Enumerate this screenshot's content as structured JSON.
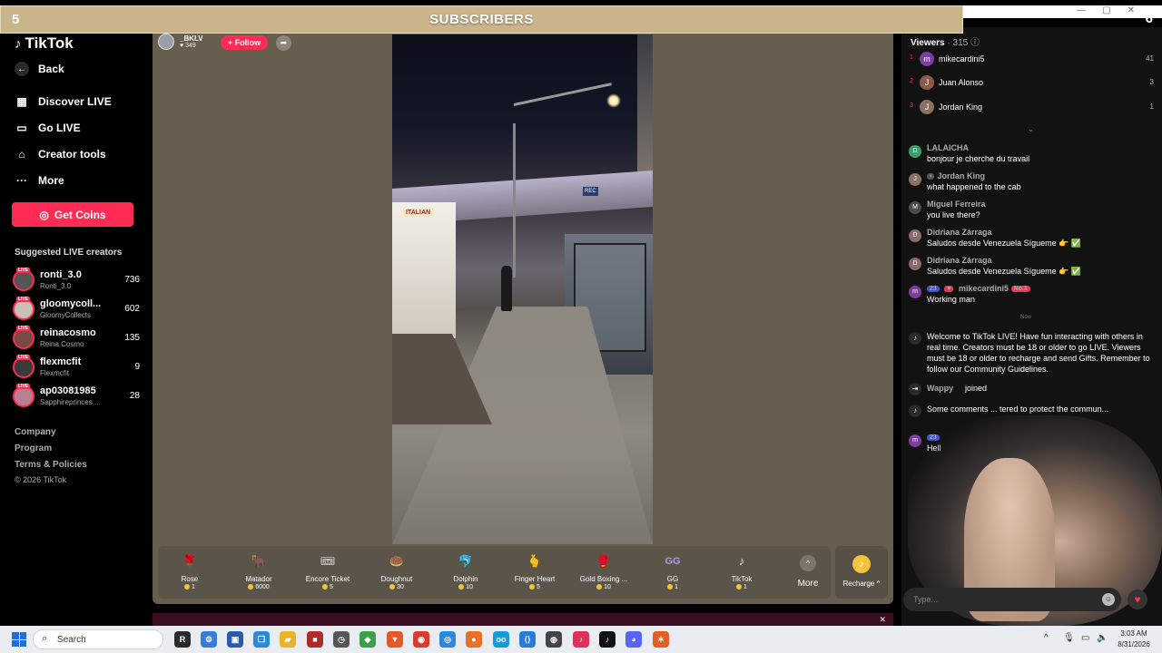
{
  "overlay": {
    "title": "SUBSCRIBERS",
    "left_count": "5",
    "right_count": "6"
  },
  "sidebar": {
    "logo": "TikTok",
    "back": "Back",
    "nav": [
      "Discover LIVE",
      "Go LIVE",
      "Creator tools",
      "More"
    ],
    "get_coins": "Get Coins",
    "suggested_title": "Suggested LIVE creators",
    "creators": [
      {
        "name": "ronti_3.0",
        "sub": "Ronti_3.0",
        "count": "736"
      },
      {
        "name": "gloomycoll...",
        "sub": "GloomyCollects",
        "count": "602"
      },
      {
        "name": "reinacosmo",
        "sub": "Reina Cosmo",
        "count": "135"
      },
      {
        "name": "flexmcfit",
        "sub": "Flexmcfit",
        "count": "9"
      },
      {
        "name": "ap03081985",
        "sub": "Sapphireprinces...",
        "count": "28"
      }
    ],
    "footer": [
      "Company",
      "Program",
      "Terms & Policies"
    ],
    "copyright": "© 2026 TikTok"
  },
  "stream": {
    "host_name": "_BKLV",
    "host_likes": "♥ 349",
    "follow": "+ Follow",
    "live_tag": "LIVE",
    "video_signs": [
      "ITALIAN",
      "REC"
    ],
    "gifts": [
      {
        "name": "Rose",
        "price": "1",
        "icon": "rose-icon",
        "glyph": "🌹",
        "color": "#c0203a"
      },
      {
        "name": "Matador",
        "price": "6000",
        "icon": "matador-icon",
        "glyph": "🐂",
        "color": "#6b4a2a"
      },
      {
        "name": "Encore Ticket",
        "price": "5",
        "icon": "ticket-icon",
        "glyph": "🎟",
        "color": "#d8323c"
      },
      {
        "name": "Doughnut",
        "price": "30",
        "icon": "doughnut-icon",
        "glyph": "🍩",
        "color": "#e88aa8"
      },
      {
        "name": "Dolphin",
        "price": "10",
        "icon": "dolphin-icon",
        "glyph": "🐬",
        "color": "#2f8fd6"
      },
      {
        "name": "Finger Heart",
        "price": "5",
        "icon": "finger-heart-icon",
        "glyph": "🫰",
        "color": "#e8a080"
      },
      {
        "name": "Gold Boxing ...",
        "price": "10",
        "icon": "boxing-glove-icon",
        "glyph": "🥊",
        "color": "#e6c23a"
      },
      {
        "name": "GG",
        "price": "1",
        "icon": "gg-icon",
        "glyph": "GG",
        "color": "#8a6ad8"
      },
      {
        "name": "TikTok",
        "price": "1",
        "icon": "tiktok-gift-icon",
        "glyph": "♪",
        "color": "#c8d8f0"
      }
    ],
    "more": "More",
    "recharge": "Recharge ^"
  },
  "chat": {
    "viewers_label": "Viewers",
    "viewers_count": "· 315",
    "top_viewers": [
      {
        "rank": "1",
        "name": "mikecardini5",
        "score": "41",
        "initial": "m"
      },
      {
        "rank": "2",
        "name": "Juan Alonso",
        "score": "3",
        "initial": "J"
      },
      {
        "rank": "3",
        "name": "Jordan King",
        "score": "1",
        "initial": "J"
      }
    ],
    "messages": [
      {
        "user": "LALAICHA",
        "text": "bonjour je cherche du travail",
        "initial": "D",
        "color": "#3aa06a"
      },
      {
        "user": "Jordan King",
        "text": "what happened to the cab",
        "initial": "J",
        "color": "#8a7060"
      },
      {
        "user": "Miguel Ferreira",
        "text": "you live there?",
        "initial": "M",
        "color": "#5a5a5a"
      },
      {
        "user": "Didriana Zárraga",
        "text": "Saludos desde Venezuela Sígueme 👉 ✅",
        "initial": "D",
        "color": "#8a6a6a"
      },
      {
        "user": "Didriana Zárraga",
        "text": "Saludos desde Venezuela Sígueme 👉 ✅",
        "initial": "D",
        "color": "#8a6a6a"
      },
      {
        "user": "mikecardini5",
        "text": "Working man",
        "initial": "m",
        "color": "#7a3ea0",
        "level": "23",
        "badge": "No.1"
      }
    ],
    "now_label": "Now",
    "welcome": "Welcome to TikTok LIVE! Have fun interacting with others in real time. Creators must be 18 or older to go LIVE. Viewers must be 18 or older to recharge and send Gifts. Remember to follow our Community Guidelines.",
    "joined_user": "Wappy",
    "joined_text": "joined",
    "filter_notice": "Some comments ... tered to protect the commun...",
    "last_level": "23",
    "last_text": "Hell",
    "input_placeholder": "Type..."
  },
  "taskbar": {
    "search_label": "Search",
    "time": "3:03 AM",
    "date": "8/31/2026"
  }
}
